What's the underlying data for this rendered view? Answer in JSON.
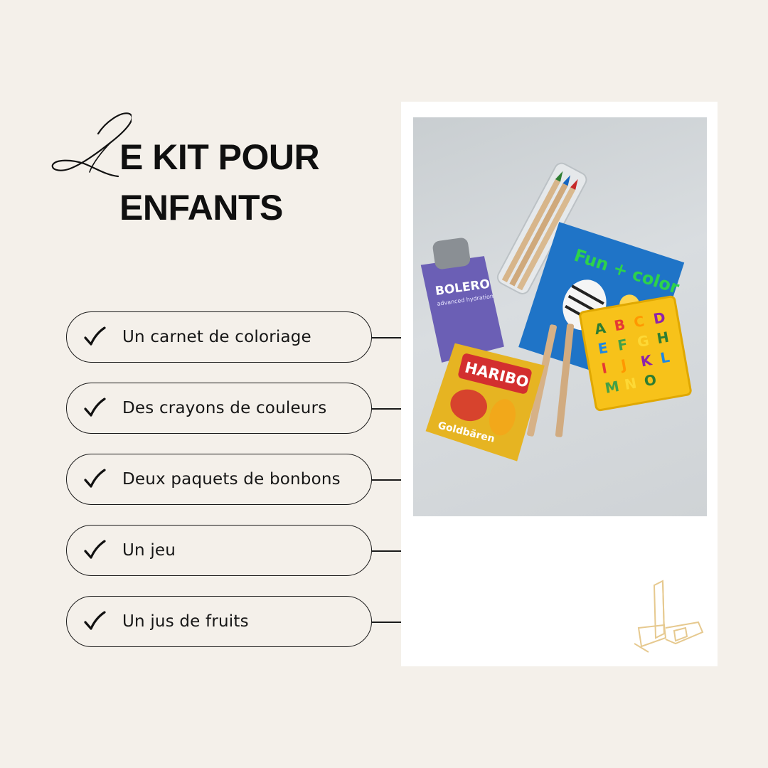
{
  "title": {
    "line1": "E KIT POUR",
    "line2": "ENFANTS",
    "script_letter": "L"
  },
  "checklist": {
    "items": [
      {
        "label": "Un carnet de coloriage",
        "icon": "check-icon"
      },
      {
        "label": "Des crayons de couleurs",
        "icon": "check-icon"
      },
      {
        "label": "Deux paquets de bonbons",
        "icon": "check-icon"
      },
      {
        "label": "Un jeu",
        "icon": "check-icon"
      },
      {
        "label": "Un jus de fruits",
        "icon": "check-icon"
      }
    ]
  },
  "photo": {
    "products": {
      "juice_brand": "BOLERO",
      "juice_subtitle": "advanced hydration",
      "candy_brand": "HARIBO",
      "candy_product": "Goldbären",
      "book_title": "Fun + color",
      "puzzle_letters": [
        "A",
        "B",
        "C",
        "D",
        "E",
        "F",
        "G",
        "H",
        "I",
        "J",
        "K",
        "L",
        "M",
        "N",
        "O"
      ]
    }
  },
  "colors": {
    "background": "#f4f0ea",
    "card": "#ffffff",
    "ink": "#111111",
    "logo_gold": "#e6c98f"
  },
  "logo": {
    "icon": "building-logo-icon"
  }
}
